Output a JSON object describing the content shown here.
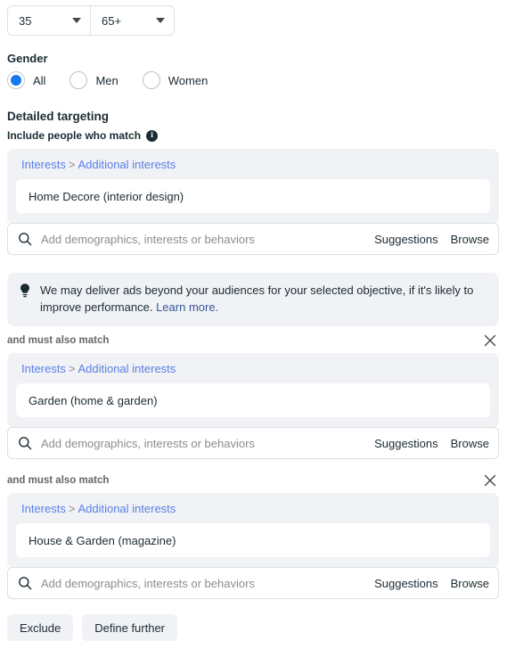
{
  "age": {
    "min_value": "35",
    "max_value": "65+",
    "caret_icon": "chevron-down-icon"
  },
  "gender": {
    "label": "Gender",
    "options": [
      {
        "label": "All",
        "selected": true
      },
      {
        "label": "Men",
        "selected": false
      },
      {
        "label": "Women",
        "selected": false
      }
    ]
  },
  "detailed_targeting": {
    "title": "Detailed targeting",
    "include_label": "Include people who match",
    "info_icon": "info-icon",
    "info_glyph": "i",
    "search": {
      "icon": "search-icon",
      "placeholder": "Add demographics, interests or behaviors",
      "suggestions_label": "Suggestions",
      "browse_label": "Browse"
    },
    "breadcrumb": {
      "root": "Interests",
      "separator": ">",
      "leaf": "Additional interests"
    },
    "and_also_label": "and must also match",
    "close_icon": "close-icon",
    "groups": [
      {
        "interest": "Home Decore (interior design)"
      },
      {
        "interest": "Garden (home & garden)"
      },
      {
        "interest": "House & Garden (magazine)"
      }
    ]
  },
  "notice": {
    "icon": "lightbulb-icon",
    "text": "We may deliver ads beyond your audiences for your selected objective, if it's likely to improve performance.",
    "link": "Learn more."
  },
  "footer": {
    "exclude_label": "Exclude",
    "define_further_label": "Define further"
  },
  "colors": {
    "accent_blue": "#1877f2",
    "link_blue": "#5a7fe8",
    "notice_link": "#385898",
    "panel_grey": "#f0f2f5",
    "border_grey": "#dddfe2",
    "text_dark": "#1c2b33",
    "text_muted": "#8a8d91"
  }
}
